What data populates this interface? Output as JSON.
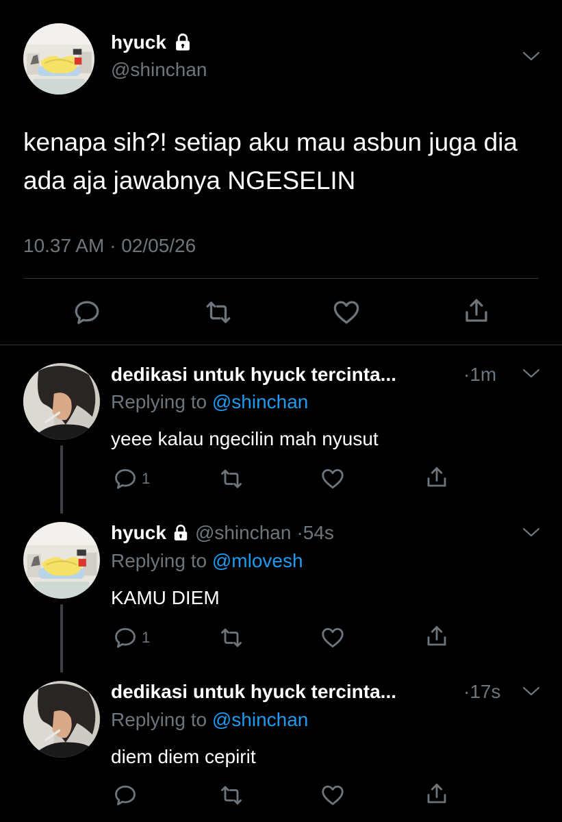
{
  "main_tweet": {
    "display_name": "hyuck",
    "handle": "@shinchan",
    "text": "kenapa sih?! setiap aku mau asbun juga dia ada aja jawabnya NGESELIN",
    "time": "10.37 AM",
    "date": "02/05/26",
    "avatar_icon": "shinchan-avatar",
    "lock_icon": "lock-icon"
  },
  "replies": [
    {
      "display_name": "dedikasi untuk hyuck tercinta...",
      "time": "1m",
      "replying_prefix": "Replying to",
      "replying_to": "@shinchan",
      "text": "yeee kalau ngecilin mah nyusut",
      "reply_count": "1",
      "avatar_icon": "person-avatar"
    },
    {
      "display_name": "hyuck",
      "handle": "@shinchan",
      "time": "54s",
      "replying_prefix": "Replying to",
      "replying_to": "@mlovesh",
      "text": "KAMU DIEM",
      "reply_count": "1",
      "avatar_icon": "shinchan-avatar"
    },
    {
      "display_name": "dedikasi untuk hyuck tercinta...",
      "time": "17s",
      "replying_prefix": "Replying to",
      "replying_to": "@shinchan",
      "text": "diem diem cepirit",
      "reply_count": "",
      "avatar_icon": "person-avatar"
    }
  ],
  "colors": {
    "background": "#000000",
    "text": "#ffffff",
    "muted": "#6e767d",
    "mention": "#1d9bf0",
    "divider": "#2f3336"
  }
}
